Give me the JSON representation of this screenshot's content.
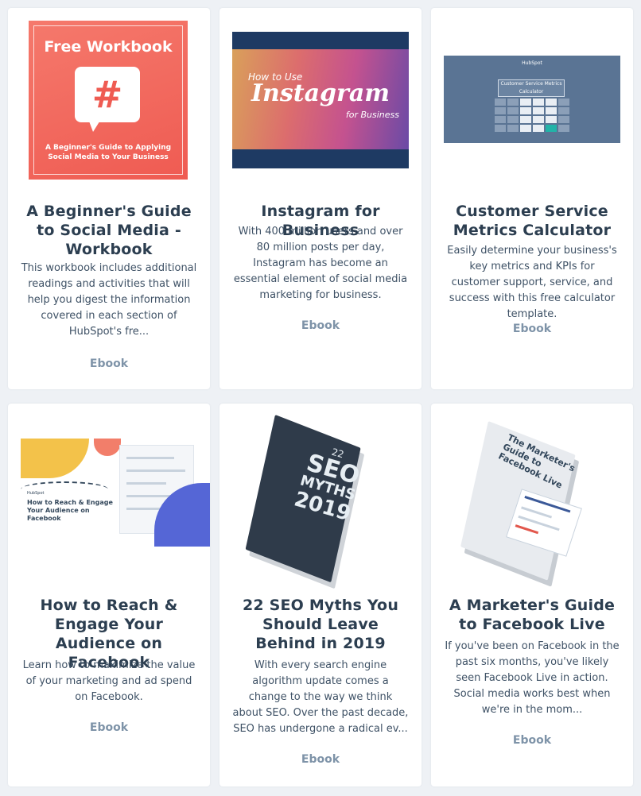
{
  "cards": [
    {
      "thumb": {
        "heading": "Free Workbook",
        "symbol": "#",
        "subtitle": "A Beginner's Guide to Applying Social Media to Your Business"
      },
      "title": "A Beginner's Guide to Social Media - Workbook",
      "description": "This workbook includes additional readings and activities that will help you digest the information covered in each section of HubSpot's fre...",
      "type": "Ebook"
    },
    {
      "thumb": {
        "line1": "How to Use",
        "line2": "Instagram",
        "line3": "for Business"
      },
      "title": "Instagram for Business",
      "description": "With 400 million users and over 80 million posts per day, Instagram has become an essential element of social media marketing for business.",
      "type": "Ebook"
    },
    {
      "thumb": {
        "brand": "HubSpot",
        "label": "Customer Service Metrics Calculator"
      },
      "title": "Customer Service Metrics Calculator",
      "description": "Easily determine your business's key metrics and KPIs for customer support, service, and success with this free calculator template.",
      "type": "Ebook"
    },
    {
      "thumb": {
        "brand": "HubSpot",
        "label": "How to Reach & Engage Your Audience on Facebook"
      },
      "title": "How to Reach & Engage Your Audience on Facebook",
      "description": "Learn how to maximize the value of your marketing and ad spend on Facebook.",
      "type": "Ebook"
    },
    {
      "thumb": {
        "number": "22",
        "word1": "SEO",
        "word2": "MYTHS",
        "year": "2019"
      },
      "title": "22 SEO Myths You Should Leave Behind in 2019",
      "description": "With every search engine algorithm update comes a change to the way we think about SEO. Over the past decade, SEO has undergone a radical ev...",
      "type": "Ebook"
    },
    {
      "thumb": {
        "label": "The Marketer's Guide to Facebook Live"
      },
      "title": "A Marketer's Guide to Facebook Live",
      "description": "If you've been on Facebook in the past six months, you've likely seen Facebook Live in action. Social media works best when we're in the mom...",
      "type": "Ebook"
    }
  ],
  "colors": {
    "background": "#eef1f5",
    "card": "#ffffff",
    "title": "#2c3e50",
    "tag": "#7e93a8"
  }
}
